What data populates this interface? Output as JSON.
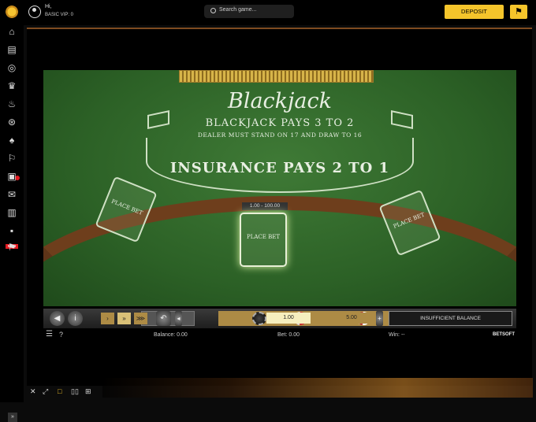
{
  "header": {
    "greeting": "Hi,",
    "vip": "BASIC VIP: 0",
    "search_placeholder": "Search game...",
    "deposit_label": "DEPOSIT",
    "promo_icon": "checkered-flag-icon"
  },
  "sidebar": {
    "new_badge": "NEW"
  },
  "table": {
    "title": "Blackjack",
    "line1": "BLACKJACK PAYS 3 TO 2",
    "line2": "DEALER MUST STAND ON 17 AND DRAW TO 16",
    "line3": "INSURANCE PAYS 2 TO 1",
    "place_bet": "PLACE BET",
    "limits": "1.00 - 100.00"
  },
  "controls": {
    "chip_value": "1.00",
    "chip_value2": "5.00",
    "message": "INSUFFICIENT BALANCE"
  },
  "info": {
    "balance": "Balance: 0.00",
    "bet": "Bet: 0.00",
    "win": "Win: --",
    "brand": "BETSOFT"
  },
  "colors": {
    "accent": "#f5c52b",
    "felt": "#2c6126",
    "badge": "#e21b22"
  }
}
